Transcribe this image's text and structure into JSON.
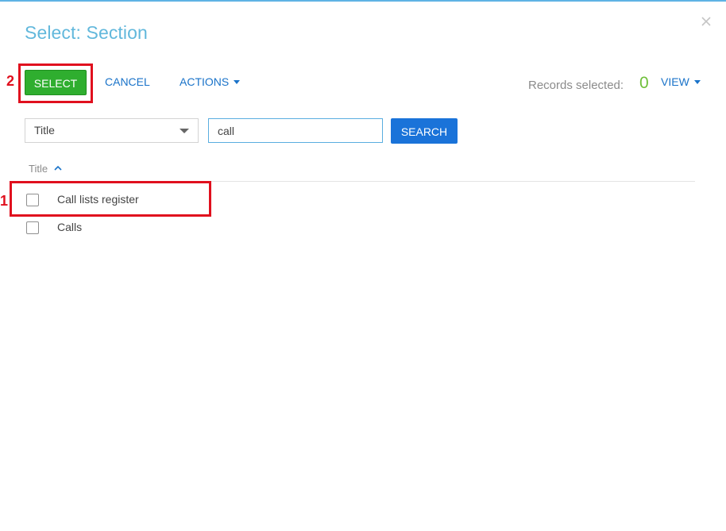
{
  "dialog": {
    "title": "Select: Section"
  },
  "toolbar": {
    "select_label": "SELECT",
    "cancel_label": "CANCEL",
    "actions_label": "ACTIONS",
    "view_label": "VIEW",
    "records_selected_label": "Records selected:",
    "records_selected_count": "0"
  },
  "filter": {
    "column_value": "Title",
    "search_value": "call",
    "search_button_label": "SEARCH"
  },
  "table": {
    "column_header": "Title",
    "sort_direction": "ascending",
    "rows": [
      {
        "label": "Call lists register",
        "checked": false
      },
      {
        "label": "Calls",
        "checked": false
      }
    ]
  },
  "annotations": {
    "marker_1": "1",
    "marker_2": "2",
    "color": "#e0101e"
  },
  "colors": {
    "select_button": "#2fae2f",
    "search_button": "#1a73d9",
    "link": "#1a73c9",
    "title": "#62b8dc",
    "count": "#6fbf3a"
  }
}
